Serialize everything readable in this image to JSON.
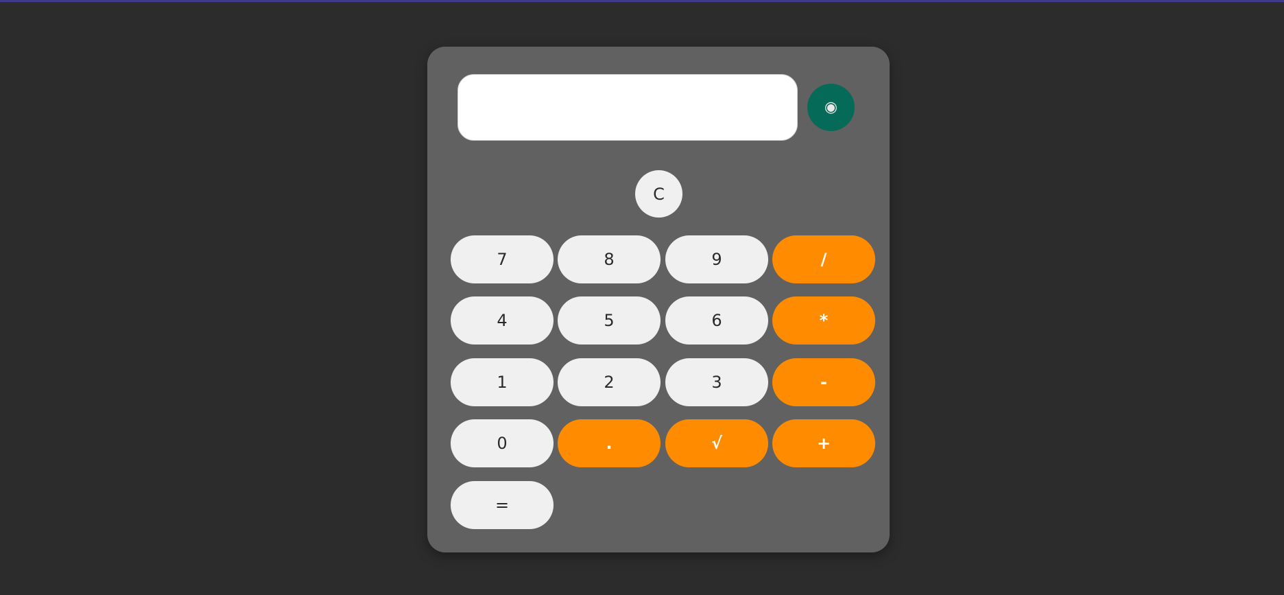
{
  "display": {
    "value": "",
    "placeholder": ""
  },
  "voice_button": {
    "glyph": "◉",
    "icon": "microphone-icon",
    "color": "#066a58"
  },
  "clear_button": {
    "label": "C"
  },
  "keys": {
    "seven": "7",
    "eight": "8",
    "nine": "9",
    "divide": "/",
    "four": "4",
    "five": "5",
    "six": "6",
    "multiply": "*",
    "one": "1",
    "two": "2",
    "three": "3",
    "subtract": "-",
    "zero": "0",
    "decimal": ".",
    "sqrt": "√",
    "add": "+",
    "equals": "="
  },
  "colors": {
    "background": "#2c2c2c",
    "panel": "#616161",
    "number_key": "#f0f0f0",
    "operator_key": "#ff8c00",
    "accent_line": "#3f3a8c"
  }
}
